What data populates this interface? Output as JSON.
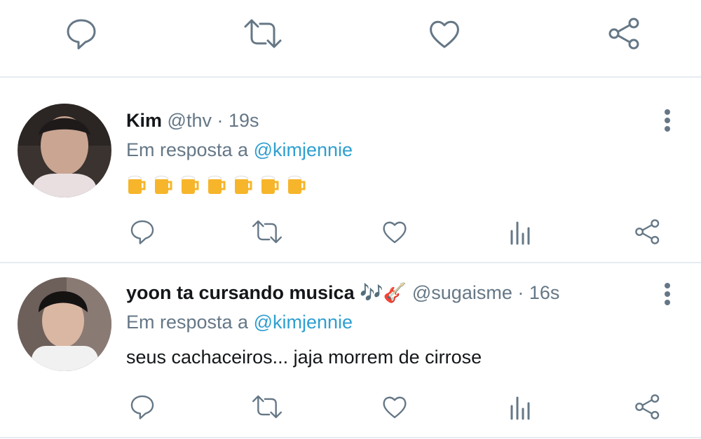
{
  "top_actions": {
    "icons": [
      "reply-icon",
      "retweet-icon",
      "like-icon",
      "share-icon"
    ]
  },
  "tweets": [
    {
      "name": "Kim",
      "handle": "@thv",
      "separator": "·",
      "time": "19s",
      "reply_prefix": "Em resposta a",
      "reply_to": "@kimjennie",
      "content": "🍺🍺🍺🍺🍺🍺🍺",
      "beer_count": 7,
      "actions": [
        "reply-icon",
        "retweet-icon",
        "like-icon",
        "analytics-icon",
        "share-icon"
      ]
    },
    {
      "name": "yoon ta cursando musica",
      "name_emoji": "🎶🎸",
      "handle": "@sugaisme",
      "separator": "·",
      "time": "16s",
      "reply_prefix": "Em resposta a",
      "reply_to": "@kimjennie",
      "content": "seus cachaceiros... jaja morrem de cirrose",
      "actions": [
        "reply-icon",
        "retweet-icon",
        "like-icon",
        "analytics-icon",
        "share-icon"
      ]
    }
  ],
  "colors": {
    "icon_gray": "#657786",
    "mention_blue": "#2f9fd0",
    "divider": "#e6ecf0"
  }
}
